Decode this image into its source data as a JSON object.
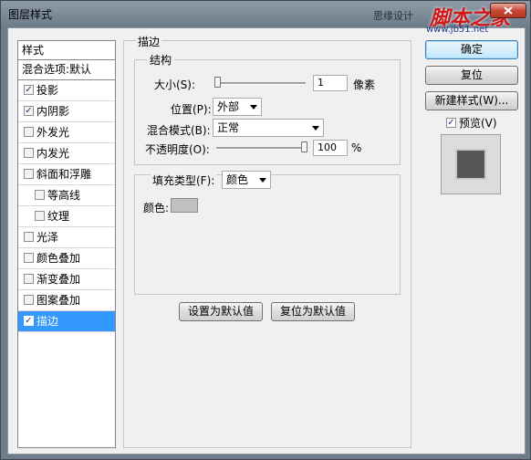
{
  "window": {
    "title": "图层样式"
  },
  "watermark": {
    "text": "思缘设计",
    "logo": "脚本之家",
    "url": "www.jb51.net"
  },
  "styles_list": {
    "header": "样式",
    "blend_options": "混合选项:默认",
    "items": [
      {
        "label": "投影",
        "checked": true,
        "sub": false,
        "selected": false
      },
      {
        "label": "内阴影",
        "checked": true,
        "sub": false,
        "selected": false
      },
      {
        "label": "外发光",
        "checked": false,
        "sub": false,
        "selected": false
      },
      {
        "label": "内发光",
        "checked": false,
        "sub": false,
        "selected": false
      },
      {
        "label": "斜面和浮雕",
        "checked": false,
        "sub": false,
        "selected": false
      },
      {
        "label": "等高线",
        "checked": false,
        "sub": true,
        "selected": false
      },
      {
        "label": "纹理",
        "checked": false,
        "sub": true,
        "selected": false
      },
      {
        "label": "光泽",
        "checked": false,
        "sub": false,
        "selected": false
      },
      {
        "label": "颜色叠加",
        "checked": false,
        "sub": false,
        "selected": false
      },
      {
        "label": "渐变叠加",
        "checked": false,
        "sub": false,
        "selected": false
      },
      {
        "label": "图案叠加",
        "checked": false,
        "sub": false,
        "selected": false
      },
      {
        "label": "描边",
        "checked": true,
        "sub": false,
        "selected": true
      }
    ]
  },
  "stroke": {
    "group_label": "描边",
    "structure_label": "结构",
    "size_label": "大小(S):",
    "size_value": "1",
    "size_unit": "像素",
    "position_label": "位置(P):",
    "position_value": "外部",
    "blend_label": "混合模式(B):",
    "blend_value": "正常",
    "opacity_label": "不透明度(O):",
    "opacity_value": "100",
    "opacity_unit": "%",
    "opacity_fraction": 1.0,
    "size_fraction": 0.0,
    "fill_type_label": "填充类型(F):",
    "fill_type_value": "颜色",
    "color_label": "颜色:",
    "color_value": "#c0c0c0"
  },
  "buttons": {
    "ok": "确定",
    "reset": "复位",
    "new_style": "新建样式(W)...",
    "preview": "预览(V)",
    "set_default": "设置为默认值",
    "reset_default": "复位为默认值"
  }
}
